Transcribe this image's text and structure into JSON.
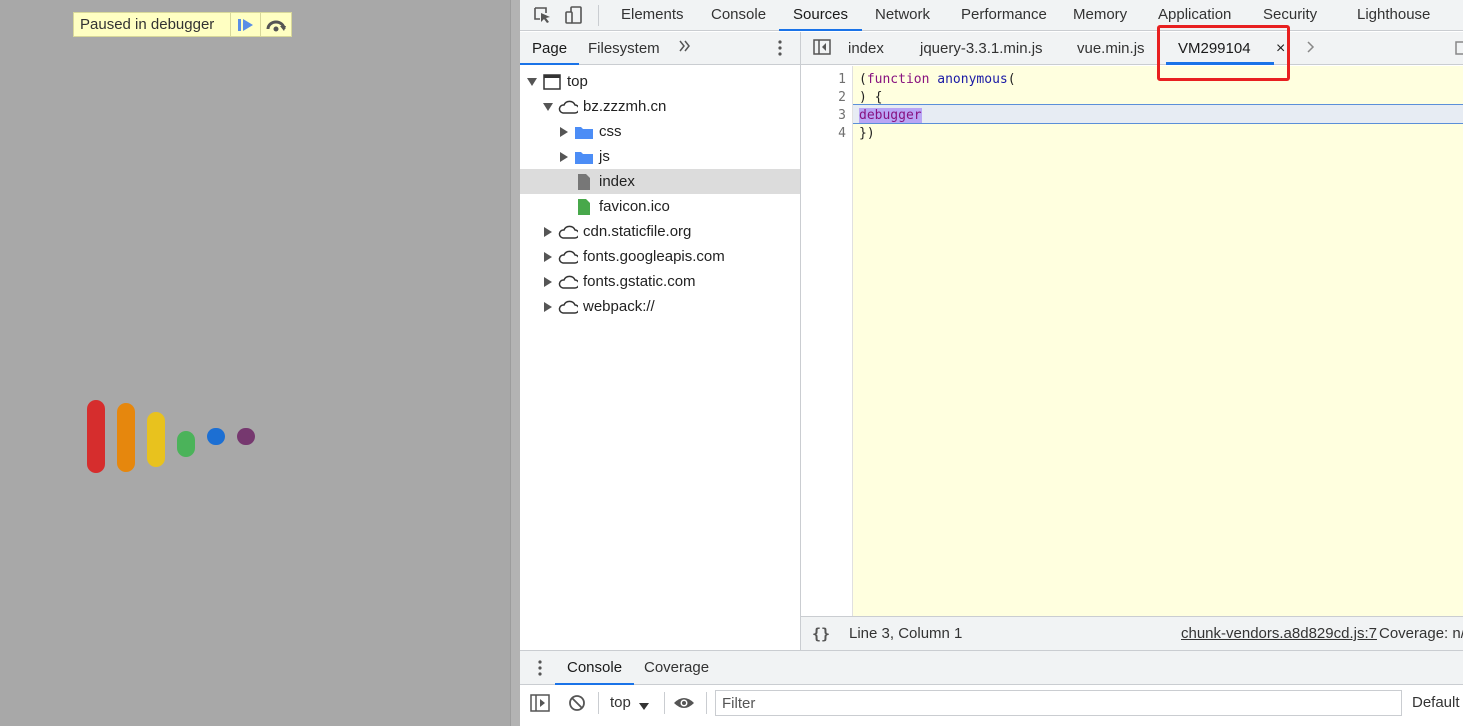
{
  "page": {
    "paused_label": "Paused in debugger",
    "loader_colors": [
      "#d62d2d",
      "#e6870d",
      "#e8c21e",
      "#4bb35a",
      "#1c6fd3",
      "#76386f"
    ]
  },
  "devtools": {
    "main_tabs": [
      "Elements",
      "Console",
      "Sources",
      "Network",
      "Performance",
      "Memory",
      "Application",
      "Security",
      "Lighthouse"
    ],
    "active_main_tab": "Sources",
    "navigator": {
      "tabs": [
        "Page",
        "Filesystem"
      ],
      "active_tab": "Page",
      "tree": [
        {
          "label": "top",
          "icon": "frame-icon"
        },
        {
          "label": "bz.zzzmh.cn",
          "icon": "cloud-icon"
        },
        {
          "label": "css",
          "icon": "folder-icon"
        },
        {
          "label": "js",
          "icon": "folder-icon"
        },
        {
          "label": "index",
          "icon": "document-icon",
          "selected": true
        },
        {
          "label": "favicon.ico",
          "icon": "image-file-icon"
        },
        {
          "label": "cdn.staticfile.org",
          "icon": "cloud-icon"
        },
        {
          "label": "fonts.googleapis.com",
          "icon": "cloud-icon"
        },
        {
          "label": "fonts.gstatic.com",
          "icon": "cloud-icon"
        },
        {
          "label": "webpack://",
          "icon": "cloud-icon"
        }
      ]
    },
    "editor": {
      "tabs": [
        "index",
        "jquery-3.3.1.min.js",
        "vue.min.js",
        "VM299104"
      ],
      "active_tab": "VM299104",
      "close_glyph": "×",
      "line_numbers": [
        "1",
        "2",
        "3",
        "4"
      ],
      "code": {
        "line1_paren": "(",
        "line1_kw": "function",
        "line1_name": "anonymous",
        "line1_tail": "(",
        "line2": ") {",
        "line3": "debugger",
        "line4": "})"
      },
      "highlight_color": "#e82020"
    },
    "status": {
      "format_icon": "{}",
      "position": "Line 3, Column 1",
      "source_link": "chunk-vendors.a8d829cd.js:7",
      "coverage": "Coverage: n/"
    },
    "drawer": {
      "tabs": [
        "Console",
        "Coverage"
      ],
      "active_tab": "Console",
      "context": "top",
      "filter_placeholder": "Filter",
      "levels": "Default"
    }
  }
}
